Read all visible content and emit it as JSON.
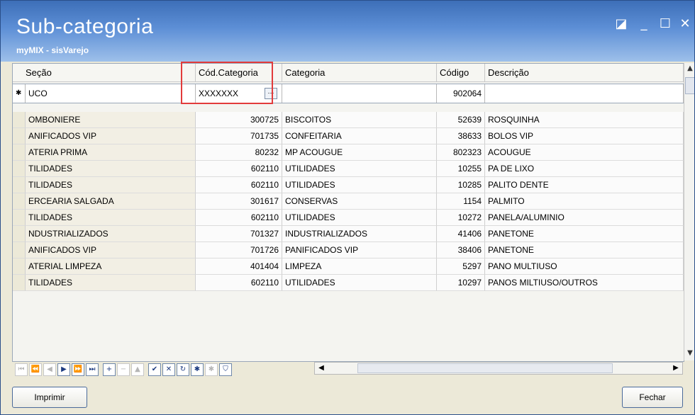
{
  "window": {
    "title": "Sub-categoria",
    "subtitle": "myMIX - sisVarejo",
    "controls": [
      "◪",
      "_",
      "☐",
      "✕"
    ]
  },
  "grid": {
    "headers": [
      "Seção",
      "Cód.Categoria",
      "Categoria",
      "Código",
      "Descrição"
    ],
    "filter": {
      "secao": "UCO",
      "cod_categoria": "XXXXXXX",
      "categoria": "",
      "codigo": "902064",
      "descricao": ""
    },
    "rows": [
      [
        "OMBONIERE",
        "300725",
        "BISCOITOS",
        "52639",
        "ROSQUINHA"
      ],
      [
        "ANIFICADOS VIP",
        "701735",
        "CONFEITARIA",
        "38633",
        "BOLOS VIP"
      ],
      [
        "ATERIA PRIMA",
        "80232",
        "MP ACOUGUE",
        "802323",
        "ACOUGUE"
      ],
      [
        "TILIDADES",
        "602110",
        "UTILIDADES",
        "10255",
        "PA DE LIXO"
      ],
      [
        "TILIDADES",
        "602110",
        "UTILIDADES",
        "10285",
        "PALITO DENTE"
      ],
      [
        "ERCEARIA SALGADA",
        "301617",
        "CONSERVAS",
        "1154",
        "PALMITO"
      ],
      [
        "TILIDADES",
        "602110",
        "UTILIDADES",
        "10272",
        "PANELA/ALUMINIO"
      ],
      [
        "NDUSTRIALIZADOS",
        "701327",
        "INDUSTRIALIZADOS",
        "41406",
        "PANETONE"
      ],
      [
        "ANIFICADOS VIP",
        "701726",
        "PANIFICADOS VIP",
        "38406",
        "PANETONE"
      ],
      [
        "ATERIAL LIMPEZA",
        "401404",
        "LIMPEZA",
        "5297",
        "PANO MULTIUSO"
      ],
      [
        "TILIDADES",
        "602110",
        "UTILIDADES",
        "10297",
        "PANOS MILTIUSO/OUTROS"
      ]
    ]
  },
  "navigator": {
    "buttons": [
      "⏮",
      "⏪",
      "◀",
      "▶",
      "⏩",
      "⏭",
      "+",
      "−",
      "▲",
      "✔",
      "✕",
      "↻",
      "✱",
      "✱",
      "⛉"
    ]
  },
  "footer": {
    "print_label": "Imprimir",
    "close_label": "Fechar"
  },
  "colors": {
    "title_gradient_top": "#3d6fb8",
    "highlight": "#e23b3b"
  }
}
